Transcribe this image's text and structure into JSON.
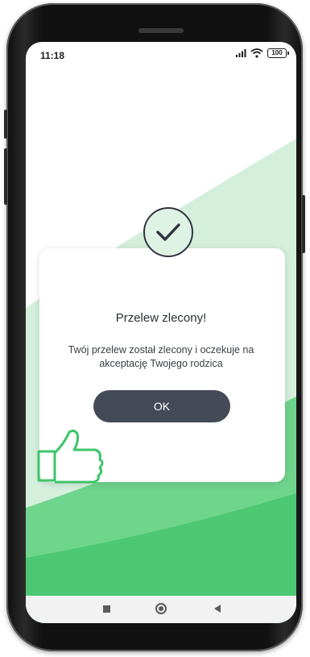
{
  "status_bar": {
    "time": "11:18",
    "battery": "100",
    "icons": [
      "signal-icon",
      "wifi-icon",
      "battery-icon"
    ]
  },
  "dialog": {
    "icon": "checkmark-icon",
    "title": "Przelew zlecony!",
    "message": "Twój przelew został zlecony i oczekuje na akceptację Twojego rodzica",
    "ok_label": "OK"
  },
  "nav_bar": {
    "icons": [
      "recents-icon",
      "home-icon",
      "back-icon"
    ]
  },
  "colors": {
    "primary_dark": "#454a57",
    "accent_green": "#3ec46a",
    "light_green": "#cdebd6"
  }
}
